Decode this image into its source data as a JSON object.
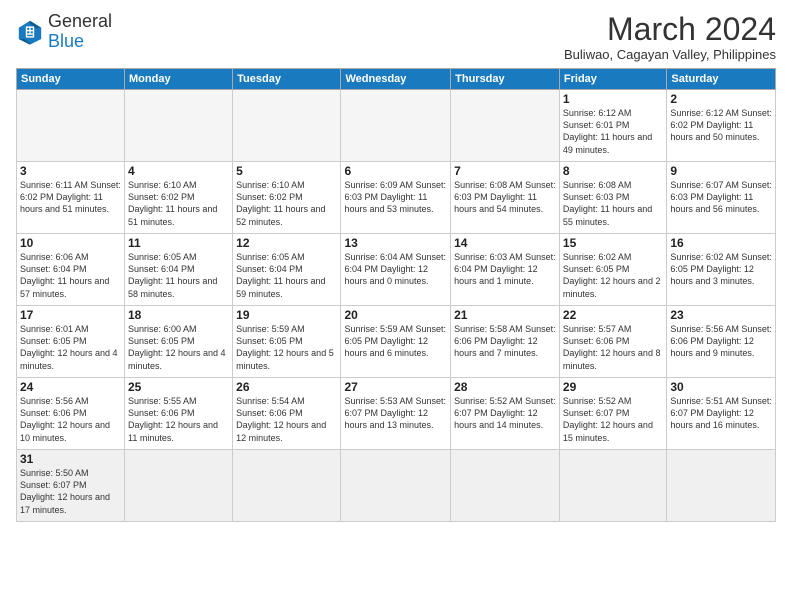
{
  "header": {
    "logo_general": "General",
    "logo_blue": "Blue",
    "month": "March 2024",
    "location": "Buliwao, Cagayan Valley, Philippines"
  },
  "weekdays": [
    "Sunday",
    "Monday",
    "Tuesday",
    "Wednesday",
    "Thursday",
    "Friday",
    "Saturday"
  ],
  "weeks": [
    [
      {
        "day": "",
        "info": ""
      },
      {
        "day": "",
        "info": ""
      },
      {
        "day": "",
        "info": ""
      },
      {
        "day": "",
        "info": ""
      },
      {
        "day": "",
        "info": ""
      },
      {
        "day": "1",
        "info": "Sunrise: 6:12 AM\nSunset: 6:01 PM\nDaylight: 11 hours and 49 minutes."
      },
      {
        "day": "2",
        "info": "Sunrise: 6:12 AM\nSunset: 6:02 PM\nDaylight: 11 hours and 50 minutes."
      }
    ],
    [
      {
        "day": "3",
        "info": "Sunrise: 6:11 AM\nSunset: 6:02 PM\nDaylight: 11 hours and 51 minutes."
      },
      {
        "day": "4",
        "info": "Sunrise: 6:10 AM\nSunset: 6:02 PM\nDaylight: 11 hours and 51 minutes."
      },
      {
        "day": "5",
        "info": "Sunrise: 6:10 AM\nSunset: 6:02 PM\nDaylight: 11 hours and 52 minutes."
      },
      {
        "day": "6",
        "info": "Sunrise: 6:09 AM\nSunset: 6:03 PM\nDaylight: 11 hours and 53 minutes."
      },
      {
        "day": "7",
        "info": "Sunrise: 6:08 AM\nSunset: 6:03 PM\nDaylight: 11 hours and 54 minutes."
      },
      {
        "day": "8",
        "info": "Sunrise: 6:08 AM\nSunset: 6:03 PM\nDaylight: 11 hours and 55 minutes."
      },
      {
        "day": "9",
        "info": "Sunrise: 6:07 AM\nSunset: 6:03 PM\nDaylight: 11 hours and 56 minutes."
      }
    ],
    [
      {
        "day": "10",
        "info": "Sunrise: 6:06 AM\nSunset: 6:04 PM\nDaylight: 11 hours and 57 minutes."
      },
      {
        "day": "11",
        "info": "Sunrise: 6:05 AM\nSunset: 6:04 PM\nDaylight: 11 hours and 58 minutes."
      },
      {
        "day": "12",
        "info": "Sunrise: 6:05 AM\nSunset: 6:04 PM\nDaylight: 11 hours and 59 minutes."
      },
      {
        "day": "13",
        "info": "Sunrise: 6:04 AM\nSunset: 6:04 PM\nDaylight: 12 hours and 0 minutes."
      },
      {
        "day": "14",
        "info": "Sunrise: 6:03 AM\nSunset: 6:04 PM\nDaylight: 12 hours and 1 minute."
      },
      {
        "day": "15",
        "info": "Sunrise: 6:02 AM\nSunset: 6:05 PM\nDaylight: 12 hours and 2 minutes."
      },
      {
        "day": "16",
        "info": "Sunrise: 6:02 AM\nSunset: 6:05 PM\nDaylight: 12 hours and 3 minutes."
      }
    ],
    [
      {
        "day": "17",
        "info": "Sunrise: 6:01 AM\nSunset: 6:05 PM\nDaylight: 12 hours and 4 minutes."
      },
      {
        "day": "18",
        "info": "Sunrise: 6:00 AM\nSunset: 6:05 PM\nDaylight: 12 hours and 4 minutes."
      },
      {
        "day": "19",
        "info": "Sunrise: 5:59 AM\nSunset: 6:05 PM\nDaylight: 12 hours and 5 minutes."
      },
      {
        "day": "20",
        "info": "Sunrise: 5:59 AM\nSunset: 6:05 PM\nDaylight: 12 hours and 6 minutes."
      },
      {
        "day": "21",
        "info": "Sunrise: 5:58 AM\nSunset: 6:06 PM\nDaylight: 12 hours and 7 minutes."
      },
      {
        "day": "22",
        "info": "Sunrise: 5:57 AM\nSunset: 6:06 PM\nDaylight: 12 hours and 8 minutes."
      },
      {
        "day": "23",
        "info": "Sunrise: 5:56 AM\nSunset: 6:06 PM\nDaylight: 12 hours and 9 minutes."
      }
    ],
    [
      {
        "day": "24",
        "info": "Sunrise: 5:56 AM\nSunset: 6:06 PM\nDaylight: 12 hours and 10 minutes."
      },
      {
        "day": "25",
        "info": "Sunrise: 5:55 AM\nSunset: 6:06 PM\nDaylight: 12 hours and 11 minutes."
      },
      {
        "day": "26",
        "info": "Sunrise: 5:54 AM\nSunset: 6:06 PM\nDaylight: 12 hours and 12 minutes."
      },
      {
        "day": "27",
        "info": "Sunrise: 5:53 AM\nSunset: 6:07 PM\nDaylight: 12 hours and 13 minutes."
      },
      {
        "day": "28",
        "info": "Sunrise: 5:52 AM\nSunset: 6:07 PM\nDaylight: 12 hours and 14 minutes."
      },
      {
        "day": "29",
        "info": "Sunrise: 5:52 AM\nSunset: 6:07 PM\nDaylight: 12 hours and 15 minutes."
      },
      {
        "day": "30",
        "info": "Sunrise: 5:51 AM\nSunset: 6:07 PM\nDaylight: 12 hours and 16 minutes."
      }
    ],
    [
      {
        "day": "31",
        "info": "Sunrise: 5:50 AM\nSunset: 6:07 PM\nDaylight: 12 hours and 17 minutes."
      },
      {
        "day": "",
        "info": ""
      },
      {
        "day": "",
        "info": ""
      },
      {
        "day": "",
        "info": ""
      },
      {
        "day": "",
        "info": ""
      },
      {
        "day": "",
        "info": ""
      },
      {
        "day": "",
        "info": ""
      }
    ]
  ]
}
